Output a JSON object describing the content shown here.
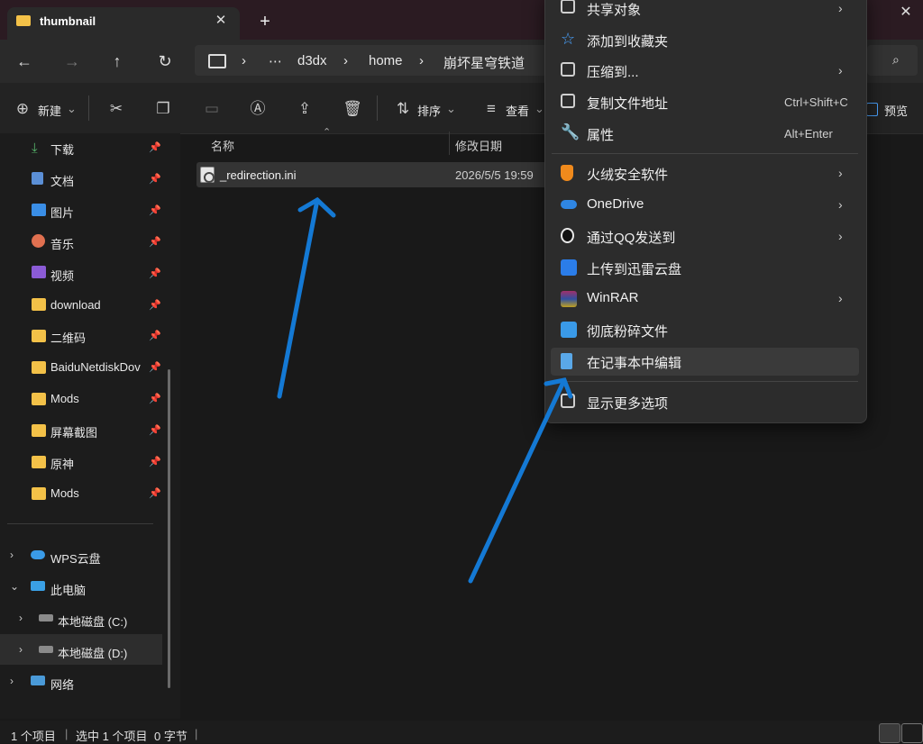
{
  "tab": {
    "title": "thumbnail",
    "close": "✕",
    "new": "+"
  },
  "window": {
    "close": "✕"
  },
  "nav": {
    "back": "←",
    "forward": "→",
    "up": "↑",
    "refresh": "↻"
  },
  "address": {
    "crumbs": [
      "⋯",
      "d3dx",
      "home",
      "崩坏星穹铁道"
    ],
    "sep": "›"
  },
  "toolbar": {
    "new_label": "新建",
    "sort_label": "排序",
    "view_label": "查看",
    "preview_label": "预览"
  },
  "sidebar": {
    "quick": [
      {
        "label": "下载",
        "icon": "download-icon"
      },
      {
        "label": "文档",
        "icon": "document-icon"
      },
      {
        "label": "图片",
        "icon": "picture-icon"
      },
      {
        "label": "音乐",
        "icon": "music-icon"
      },
      {
        "label": "视频",
        "icon": "video-icon"
      },
      {
        "label": "download",
        "icon": "folder-icon"
      },
      {
        "label": "二维码",
        "icon": "folder-icon"
      },
      {
        "label": "BaiduNetdiskDov",
        "icon": "folder-icon"
      },
      {
        "label": "Mods",
        "icon": "folder-icon"
      },
      {
        "label": "屏幕截图",
        "icon": "folder-icon"
      },
      {
        "label": "原神",
        "icon": "folder-icon"
      },
      {
        "label": "Mods",
        "icon": "folder-icon"
      }
    ],
    "tree": [
      {
        "label": "WPS云盘"
      },
      {
        "label": "此电脑"
      },
      {
        "label": "本地磁盘 (C:)"
      },
      {
        "label": "本地磁盘 (D:)"
      },
      {
        "label": "网络"
      }
    ]
  },
  "columns": {
    "name": "名称",
    "modified": "修改日期"
  },
  "files": [
    {
      "name": "_redirection.ini",
      "modified": "2026/5/5 19:59"
    }
  ],
  "context_menu": {
    "items": [
      {
        "label": "共享对象",
        "arrow": "›"
      },
      {
        "label": "添加到收藏夹"
      },
      {
        "label": "压缩到...",
        "arrow": "›"
      },
      {
        "label": "复制文件地址",
        "shortcut": "Ctrl+Shift+C"
      },
      {
        "label": "属性",
        "shortcut": "Alt+Enter"
      },
      {
        "label": "火绒安全软件",
        "arrow": "›"
      },
      {
        "label": "OneDrive",
        "arrow": "›"
      },
      {
        "label": "通过QQ发送到",
        "arrow": "›"
      },
      {
        "label": "上传到迅雷云盘"
      },
      {
        "label": "WinRAR",
        "arrow": "›"
      },
      {
        "label": "彻底粉碎文件"
      },
      {
        "label": "在记事本中编辑"
      },
      {
        "label": "显示更多选项"
      }
    ]
  },
  "status": {
    "count": "1 个项目",
    "selected": "选中 1 个项目",
    "size": "0 字节"
  },
  "colors": {
    "accent": "#0f78d4",
    "folder": "#f3c148",
    "arrow": "#1479d4"
  }
}
